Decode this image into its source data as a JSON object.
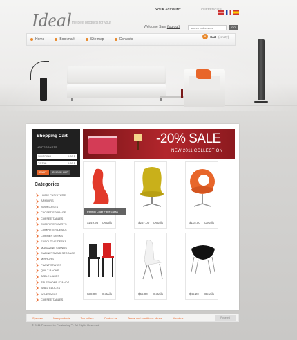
{
  "header": {
    "logo": "Ideal",
    "tagline": "the best products for you!",
    "account_title": "YOUR ACCOUNT",
    "welcome_text": "Welcome Sam",
    "logout_label": "(log out)",
    "currencies_label": "CURRENCIES",
    "search_placeholder": "search entire store",
    "search_button": "GO"
  },
  "nav": {
    "items": [
      {
        "label": "Home"
      },
      {
        "label": "Bookmark"
      },
      {
        "label": "Site map"
      },
      {
        "label": "Contacts"
      }
    ],
    "cart_label": "Cart",
    "cart_value": "(empty)"
  },
  "sidebar": {
    "cart_title": "Shopping Cart",
    "no_products": "NO PRODUCTS",
    "shipping_label": "SHIPPING",
    "shipping_value": "0.00 $",
    "total_label": "TOTAL",
    "total_value": "0.00 $",
    "cart_button": "CART",
    "checkout_button": "CHECK OUT",
    "categories_title": "Categories",
    "categories": [
      "HOME FURNITURE",
      "ARMOIRS",
      "BOOKCASES",
      "CLOSET STORAGE",
      "COFFEE TABLES",
      "COMPUTER CARTS",
      "COMPUTER DESKS",
      "CORNER DESKS",
      "EXECUTIVE DESKS",
      "MAGAZINE STANDS",
      "CABINETS AND STORAGE",
      "MIRRORS",
      "PLANT STANDS",
      "QUILT RACKS",
      "TABLE LAMPS",
      "TELEPHONE STANDS",
      "WALL CLOCKS",
      "WINERACKS",
      "COFFEE TABLES"
    ]
  },
  "banner": {
    "sale_text": "-20% SALE",
    "sub_text": "NEW 2011 COLLECTION"
  },
  "products": [
    {
      "price": "$149.95",
      "details": "Details",
      "caption": "Panton Chair Fibre Glass"
    },
    {
      "price": "$257.00",
      "details": "Details"
    },
    {
      "price": "$115.50",
      "details": "Details"
    },
    {
      "price": "$38.00",
      "details": "Details"
    },
    {
      "price": "$55.00",
      "details": "Details"
    },
    {
      "price": "$45.20",
      "details": "Details"
    }
  ],
  "footer": {
    "links": [
      "Specials",
      "New products",
      "Top sellers",
      "Contact us",
      "Terms and conditions of use",
      "About us"
    ],
    "copyright": "© 2011 Powered by Prestashop™. All Rights Reserved",
    "badge": "Powered"
  },
  "colors": {
    "accent": "#e8662a",
    "dark": "#202020",
    "banner": "#b3262c"
  }
}
